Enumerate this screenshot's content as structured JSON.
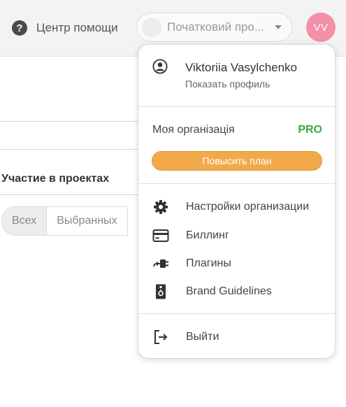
{
  "header": {
    "help_label": "Центр помощи",
    "help_icon": "question-circle-icon",
    "project_select_value": "Початковий про...",
    "avatar_initials": "VV",
    "avatar_color": "#f48fa7"
  },
  "page": {
    "section_title": "Участие в проектах",
    "filter_tabs": [
      "Всех",
      "Выбранных"
    ]
  },
  "menu": {
    "user_name": "Viktoriia Vasylchenko",
    "profile_link": "Показать профиль",
    "org_label": "Моя організація",
    "plan_badge": "PRO",
    "plan_badge_color": "#3aab3a",
    "upgrade_button": "Повысить план",
    "upgrade_color": "#f1a94a",
    "items": [
      {
        "label": "Настройки организации",
        "icon": "gear-icon"
      },
      {
        "label": "Биллинг",
        "icon": "credit-card-icon"
      },
      {
        "label": "Плагины",
        "icon": "plug-icon"
      },
      {
        "label": "Brand Guidelines",
        "icon": "brand-book-icon"
      }
    ],
    "logout_label": "Выйти"
  }
}
